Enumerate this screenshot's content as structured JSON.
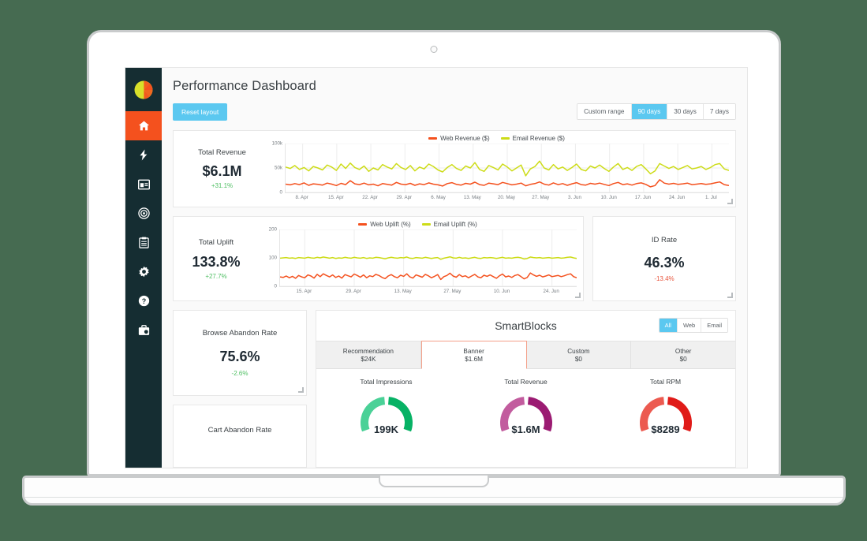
{
  "window": {
    "device": "laptop-mockup",
    "background_color": "#466b51"
  },
  "sidebar": {
    "logo_name": "pie-chart-logo",
    "items": [
      {
        "icon": "home-icon",
        "name": "home",
        "active": true
      },
      {
        "icon": "lightning-bolt-icon",
        "name": "campaigns",
        "active": false
      },
      {
        "icon": "layout-icon",
        "name": "content",
        "active": false
      },
      {
        "icon": "target-icon",
        "name": "audiences",
        "active": false
      },
      {
        "icon": "clipboard-icon",
        "name": "reports",
        "active": false
      },
      {
        "icon": "gear-icon",
        "name": "settings",
        "active": false
      },
      {
        "icon": "help-circle-icon",
        "name": "help",
        "active": false
      },
      {
        "icon": "briefcase-icon",
        "name": "account",
        "active": false
      }
    ]
  },
  "header": {
    "title": "Performance Dashboard",
    "reset_label": "Reset layout",
    "date_range": {
      "options": [
        "Custom range",
        "90 days",
        "30 days",
        "7 days"
      ],
      "selected": "90 days"
    }
  },
  "colors": {
    "accent_blue": "#5bc8f0",
    "active_orange": "#f4511e",
    "web_series": "#f4511e",
    "email_series": "#cddc18",
    "positive": "#4fbf63",
    "negative": "#e8573f",
    "sidebar_bg": "#152d32"
  },
  "revenue_card": {
    "label": "Total Revenue",
    "value": "$6.1M",
    "delta": "+31.1%",
    "delta_direction": "up"
  },
  "uplift_card": {
    "label": "Total Uplift",
    "value": "133.8%",
    "delta": "+27.7%",
    "delta_direction": "up"
  },
  "id_rate_card": {
    "label": "ID Rate",
    "value": "46.3%",
    "delta": "-13.4%",
    "delta_direction": "down"
  },
  "browse_abandon_card": {
    "label": "Browse Abandon Rate",
    "value": "75.6%",
    "delta": "-2.6%",
    "delta_direction": "up"
  },
  "cart_abandon_card": {
    "label": "Cart Abandon Rate"
  },
  "smartblocks": {
    "title": "SmartBlocks",
    "channel_filter": {
      "options": [
        "All",
        "Web",
        "Email"
      ],
      "selected": "All"
    },
    "tabs": [
      {
        "name": "Recommendation",
        "value": "$24K",
        "active": false
      },
      {
        "name": "Banner",
        "value": "$1.6M",
        "active": true
      },
      {
        "name": "Custom",
        "value": "$0",
        "active": false
      },
      {
        "name": "Other",
        "value": "$0",
        "active": false
      }
    ],
    "metrics": [
      {
        "label": "Total Impressions",
        "value": "199K",
        "color_light": "#4ad197",
        "color_dark": "#07b265",
        "percent": 78
      },
      {
        "label": "Total Revenue",
        "value": "$1.6M",
        "color_light": "#c25c9e",
        "color_dark": "#9b1b72",
        "percent": 78
      },
      {
        "label": "Total RPM",
        "value": "$8289",
        "color_light": "#ec5a50",
        "color_dark": "#e01b18",
        "percent": 78
      }
    ]
  },
  "chart_data": [
    {
      "type": "line",
      "id": "total-revenue-chart",
      "title": "",
      "xlabel": "",
      "ylabel": "",
      "ylim": [
        0,
        100000
      ],
      "yticks": [
        "0",
        "50k",
        "100k"
      ],
      "ytick_values": [
        0,
        50000,
        100000
      ],
      "grid": true,
      "legend_position": "top-center",
      "xticks": [
        "8. Apr",
        "15. Apr",
        "22. Apr",
        "29. Apr",
        "6. May",
        "13. May",
        "20. May",
        "27. May",
        "3. Jun",
        "10. Jun",
        "17. Jun",
        "24. Jun",
        "1. Jul"
      ],
      "series": [
        {
          "name": "Web Revenue ($)",
          "color": "#f4511e",
          "values": [
            17000,
            15500,
            18000,
            16000,
            19500,
            14500,
            17500,
            16500,
            15000,
            19000,
            17000,
            14000,
            18500,
            16000,
            24000,
            17500,
            16000,
            19000,
            15500,
            17000,
            13500,
            18000,
            16500,
            15000,
            20500,
            17000,
            16000,
            18500,
            14500,
            17500,
            16000,
            19500,
            17000,
            15500,
            13000,
            18000,
            20000,
            16500,
            15000,
            18500,
            17000,
            21000,
            16000,
            14500,
            19000,
            17500,
            16000,
            20500,
            18000,
            15500,
            17000,
            19000,
            13500,
            16500,
            18000,
            21500,
            17000,
            15000,
            19500,
            16000,
            18000,
            14500,
            17500,
            20000,
            16000,
            15000,
            18500,
            17000,
            19000,
            16500,
            14000,
            18000,
            20500,
            16000,
            17500,
            15000,
            18000,
            19500,
            16500,
            11500,
            14000,
            26000,
            19000,
            17000,
            18500,
            16500,
            17500,
            19000,
            16000,
            17000,
            18000,
            16500,
            17500,
            19500,
            21500,
            16000,
            14000
          ]
        },
        {
          "name": "Email Revenue ($)",
          "color": "#cddc18",
          "values": [
            52000,
            49000,
            55000,
            47000,
            51000,
            44000,
            53000,
            50000,
            46000,
            56000,
            52000,
            45000,
            58000,
            49000,
            60000,
            51000,
            47000,
            54000,
            43000,
            50000,
            46000,
            57000,
            52000,
            48000,
            59000,
            51000,
            47000,
            55000,
            44000,
            52000,
            48000,
            58000,
            53000,
            46000,
            42000,
            51000,
            57000,
            49000,
            45000,
            54000,
            50000,
            61000,
            47000,
            43000,
            55000,
            51000,
            46000,
            58000,
            52000,
            44000,
            50000,
            56000,
            34000,
            48000,
            53000,
            64000,
            50000,
            46000,
            57000,
            48000,
            52000,
            45000,
            51000,
            58000,
            47000,
            44000,
            54000,
            50000,
            56000,
            49000,
            43000,
            52000,
            59000,
            47000,
            51000,
            45000,
            53000,
            57000,
            48000,
            38000,
            44000,
            59000,
            54000,
            49000,
            53000,
            47000,
            51000,
            55000,
            48000,
            50000,
            53000,
            47000,
            51000,
            57000,
            59000,
            48000,
            45000
          ]
        }
      ]
    },
    {
      "type": "line",
      "id": "total-uplift-chart",
      "title": "",
      "xlabel": "",
      "ylabel": "",
      "ylim": [
        0,
        200
      ],
      "yticks": [
        "0",
        "100",
        "200"
      ],
      "ytick_values": [
        0,
        100,
        200
      ],
      "grid": true,
      "legend_position": "top-center",
      "xticks": [
        "15. Apr",
        "29. Apr",
        "13. May",
        "27. May",
        "10. Jun",
        "24. Jun"
      ],
      "series": [
        {
          "name": "Web Uplift (%)",
          "color": "#f4511e",
          "values": [
            33,
            31,
            36,
            30,
            35,
            28,
            38,
            33,
            30,
            40,
            36,
            29,
            42,
            34,
            44,
            38,
            33,
            40,
            31,
            36,
            29,
            41,
            37,
            33,
            43,
            38,
            32,
            40,
            30,
            37,
            34,
            42,
            38,
            31,
            27,
            36,
            41,
            34,
            30,
            39,
            35,
            44,
            33,
            29,
            40,
            36,
            32,
            42,
            37,
            30,
            35,
            41,
            24,
            34,
            38,
            46,
            36,
            32,
            41,
            34,
            37,
            30,
            36,
            42,
            33,
            30,
            39,
            35,
            40,
            34,
            28,
            37,
            43,
            33,
            36,
            31,
            38,
            41,
            34,
            26,
            31,
            47,
            40,
            35,
            39,
            33,
            36,
            40,
            34,
            36,
            38,
            34,
            37,
            41,
            44,
            34,
            30
          ]
        },
        {
          "name": "Email Uplift (%)",
          "color": "#cddc18",
          "values": [
            99,
            100,
            101,
            99,
            100,
            98,
            101,
            100,
            99,
            102,
            100,
            99,
            102,
            100,
            103,
            101,
            99,
            101,
            98,
            100,
            99,
            102,
            100,
            99,
            102,
            100,
            99,
            101,
            98,
            100,
            99,
            102,
            101,
            99,
            97,
            100,
            102,
            100,
            99,
            101,
            100,
            103,
            99,
            98,
            101,
            100,
            99,
            102,
            100,
            98,
            100,
            101,
            95,
            99,
            101,
            104,
            100,
            99,
            102,
            99,
            100,
            98,
            100,
            102,
            99,
            98,
            101,
            100,
            101,
            100,
            98,
            100,
            102,
            99,
            100,
            99,
            101,
            102,
            100,
            96,
            98,
            103,
            101,
            100,
            101,
            99,
            100,
            101,
            99,
            100,
            101,
            99,
            100,
            102,
            103,
            100,
            98
          ]
        }
      ]
    }
  ]
}
